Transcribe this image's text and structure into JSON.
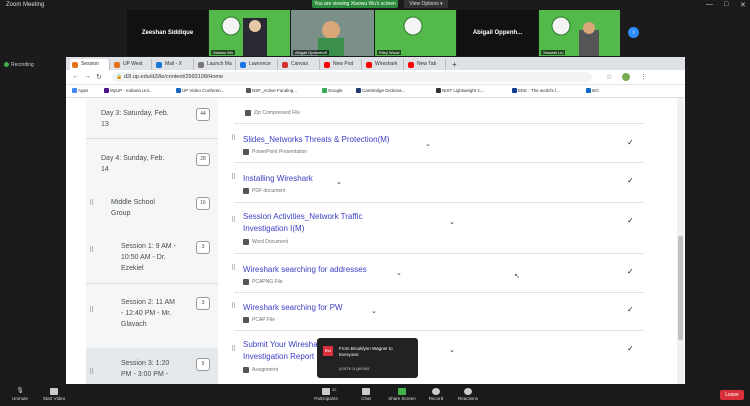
{
  "zoom": {
    "window_title": "Zoom Meeting",
    "banner": "You are viewing Xiaowu Wu's screen",
    "view_options": "View Options ▾",
    "win_controls": [
      "—",
      "□",
      "✕"
    ],
    "participants": [
      {
        "name": "Zeeshan Siddique",
        "type": "dark"
      },
      {
        "name": "Xiaowu Wu",
        "type": "video"
      },
      {
        "name": "Abigail Opdenhoff",
        "type": "video"
      },
      {
        "name": "Riley Wood",
        "type": "video"
      },
      {
        "name": "Abigail Oppenh...",
        "type": "dark"
      },
      {
        "name": "Xiaowei Liu",
        "type": "video"
      }
    ],
    "recording_label": "Recording",
    "toolbar": [
      {
        "label": "Unmute",
        "icon": "microphone-icon"
      },
      {
        "label": "Start Video",
        "icon": "video-icon"
      },
      {
        "label": "Participants",
        "icon": "participants-icon",
        "badge": "32"
      },
      {
        "label": "Chat",
        "icon": "chat-icon"
      },
      {
        "label": "Share Screen",
        "icon": "share-screen-icon"
      },
      {
        "label": "Record",
        "icon": "record-icon"
      },
      {
        "label": "Reactions",
        "icon": "reactions-icon"
      }
    ],
    "leave_label": "Leave",
    "notification": {
      "icon_text": "BW",
      "from_line1": "From Brooklynn Wagner to",
      "from_line2": "Everyone:",
      "message": "you're a genius"
    }
  },
  "browser": {
    "tabs": [
      {
        "label": "Session",
        "color": "#e8711a"
      },
      {
        "label": "UP West",
        "color": "#e8711a"
      },
      {
        "label": "Mail - X",
        "color": "#1976d2"
      },
      {
        "label": "Launch Ma",
        "color": "#777777"
      },
      {
        "label": "Lawrence",
        "color": "#1a73e8"
      },
      {
        "label": "Canvas",
        "color": "#d32f2f"
      },
      {
        "label": "New Pod",
        "color": "#ff0000"
      },
      {
        "label": "Wireshark",
        "color": "#ff0000"
      },
      {
        "label": "New Tab",
        "color": "#ff0000"
      }
    ],
    "new_tab": "+",
    "url": "d2l.up.edu/d2l/le/content/2993108/Home",
    "bookmarks": [
      {
        "label": "Apps",
        "color": "#4285f4"
      },
      {
        "label": "MyUP · Indiana Uni...",
        "color": "#4a148c"
      },
      {
        "label": "UP Video Conferen...",
        "color": "#1565c0"
      },
      {
        "label": "NSF_Active Funding...",
        "color": "#555555"
      },
      {
        "label": "Google",
        "color": "#34a853"
      },
      {
        "label": "Cambridge Dictiona...",
        "color": "#1e3a6e"
      },
      {
        "label": "NIST Lightweight C...",
        "color": "#333333"
      },
      {
        "label": "EEE · The world's l...",
        "color": "#0a3d91"
      },
      {
        "label": "IEC",
        "color": "#0a66c2"
      }
    ]
  },
  "sidebar": {
    "items": [
      {
        "label_lines": [
          "Day 3: Saturday, Feb.",
          "13"
        ],
        "count": "44"
      },
      {
        "label_lines": [
          "Day 4: Sunday, Feb.",
          "14"
        ],
        "count": "28"
      },
      {
        "label_lines": [
          "Middle School",
          "Group"
        ],
        "count": "16"
      },
      {
        "label_lines": [
          "Session 1: 9 AM -",
          "10:50 AM - Dr.",
          "Ezekiel"
        ],
        "count": "3"
      },
      {
        "label_lines": [
          "Session 2: 11 AM",
          "- 12:40 PM - Mr.",
          "Glavach"
        ],
        "count": "3"
      },
      {
        "label_lines": [
          "Session 3: 1:20",
          "PM - 3:00 PM -"
        ],
        "count": "9"
      }
    ]
  },
  "main": {
    "items": [
      {
        "title_lines": [
          "Zip Compressed File"
        ],
        "sub": ""
      },
      {
        "title_lines": [
          "Slides_Networks Threats & Protection(M)"
        ],
        "sub": "PowerPoint Presentation"
      },
      {
        "title_lines": [
          "Installing Wireshark"
        ],
        "sub": "PDF document"
      },
      {
        "title_lines": [
          "Session Activities_Network Traffic",
          "Investigation I(M)"
        ],
        "sub": "Word Document"
      },
      {
        "title_lines": [
          "Wireshark searching for addresses"
        ],
        "sub": "PCAPNG File"
      },
      {
        "title_lines": [
          "Wireshark searching for PW"
        ],
        "sub": "PCAP File"
      },
      {
        "title_lines": [
          "Submit Your Wireshark Traffic",
          "Investigation Report"
        ],
        "sub": "Assignment"
      }
    ]
  }
}
